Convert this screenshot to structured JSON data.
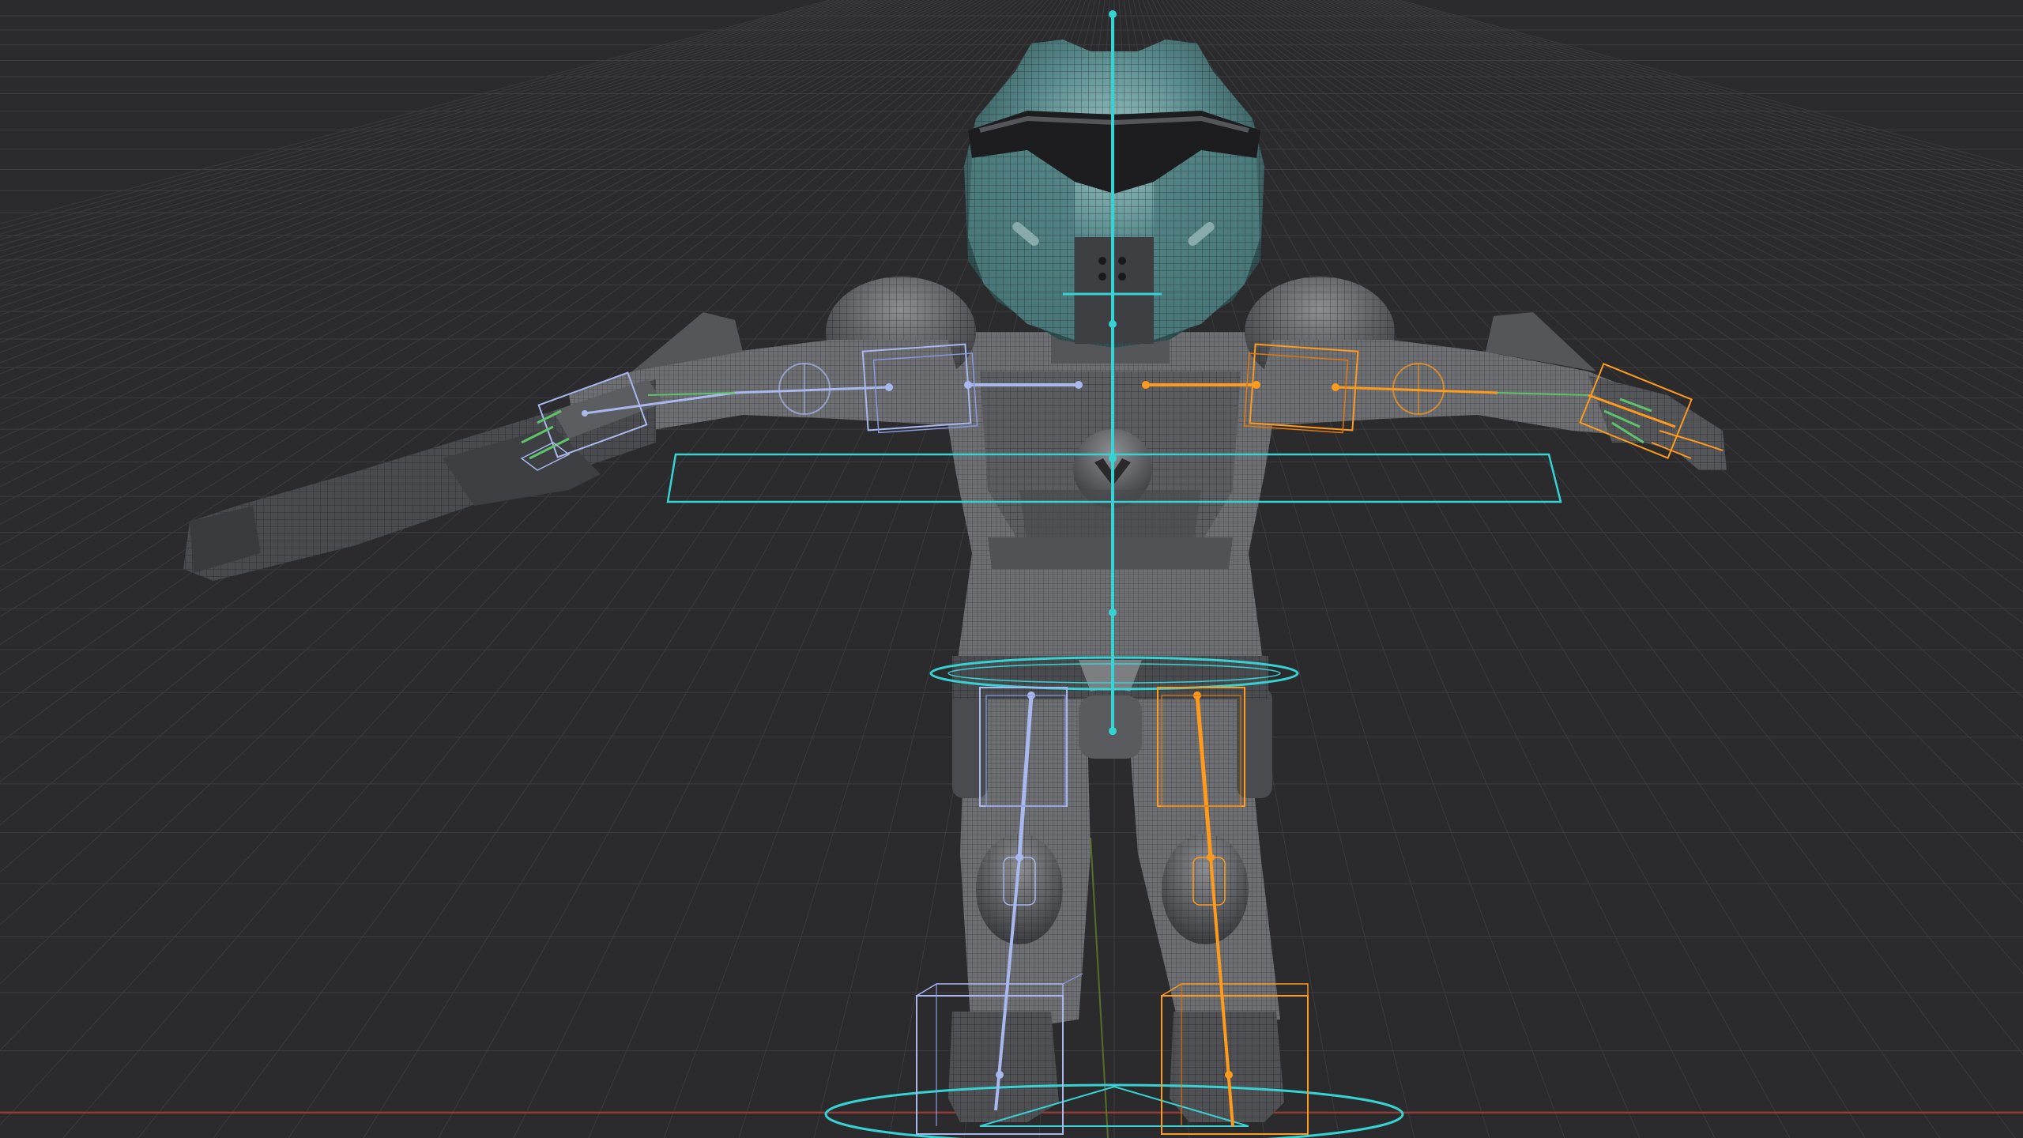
{
  "viewport": {
    "background": "#2b2b2d",
    "grid_color": "#3c3c40",
    "x_axis_color": "#c0392b",
    "y_axis_color": "#6a8a2a"
  },
  "rig": {
    "center_color": "#35d3d3",
    "left_color": "#a9b8ee",
    "right_color": "#ff9a1a",
    "ik_color": "#5ec46a"
  },
  "character": {
    "suit_color": "#6e6f73",
    "armor_color": "#4a4b4f",
    "helmet_color": "#5a8c8e",
    "visor_color": "#1d1d20",
    "wire_color": "#1a1a1c"
  }
}
